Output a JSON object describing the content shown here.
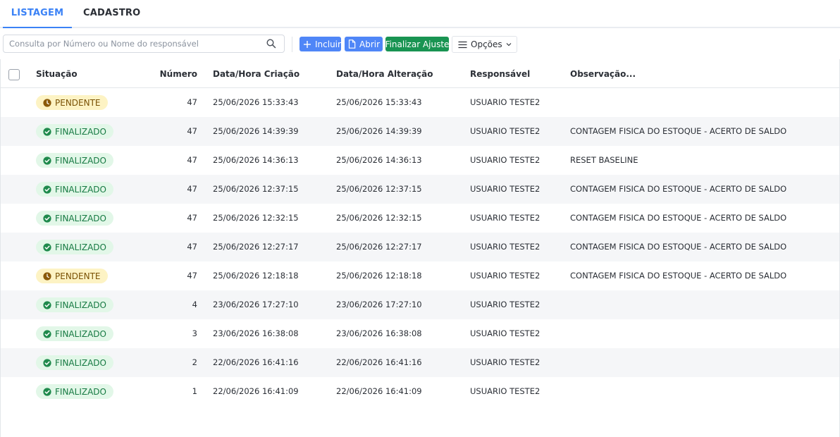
{
  "tabs": [
    {
      "label": "LISTAGEM"
    },
    {
      "label": "CADASTRO"
    }
  ],
  "search": {
    "placeholder": "Consulta por Número ou Nome do responsável",
    "value": ""
  },
  "toolbar": {
    "incluir_label": "Incluir",
    "abrir_label": "Abrir",
    "finalizar_label": "Finalizar Ajuste",
    "opcoes_label": "Opções"
  },
  "colors": {
    "accent": "#3b82f6",
    "blue_button": "#4f86f7",
    "green_button": "#199452",
    "finalizado": "#177a43",
    "pendente": "#7a5205"
  },
  "table": {
    "headers": {
      "situacao": "Situação",
      "numero": "Número",
      "criacao": "Data/Hora Criação",
      "alteracao": "Data/Hora Alteração",
      "responsavel": "Responsável",
      "observacao": "Observação..."
    },
    "rows": [
      {
        "situacao": "PENDENTE",
        "numero": "47",
        "criacao": "25/06/2026 15:33:43",
        "alteracao": "25/06/2026 15:33:43",
        "responsavel": "USUARIO TESTE2",
        "observacao": ""
      },
      {
        "situacao": "FINALIZADO",
        "numero": "47",
        "criacao": "25/06/2026 14:39:39",
        "alteracao": "25/06/2026 14:39:39",
        "responsavel": "USUARIO TESTE2",
        "observacao": "CONTAGEM FISICA DO ESTOQUE - ACERTO DE SALDO"
      },
      {
        "situacao": "FINALIZADO",
        "numero": "47",
        "criacao": "25/06/2026 14:36:13",
        "alteracao": "25/06/2026 14:36:13",
        "responsavel": "USUARIO TESTE2",
        "observacao": "RESET BASELINE"
      },
      {
        "situacao": "FINALIZADO",
        "numero": "47",
        "criacao": "25/06/2026 12:37:15",
        "alteracao": "25/06/2026 12:37:15",
        "responsavel": "USUARIO TESTE2",
        "observacao": "CONTAGEM FISICA DO ESTOQUE - ACERTO DE SALDO"
      },
      {
        "situacao": "FINALIZADO",
        "numero": "47",
        "criacao": "25/06/2026 12:32:15",
        "alteracao": "25/06/2026 12:32:15",
        "responsavel": "USUARIO TESTE2",
        "observacao": "CONTAGEM FISICA DO ESTOQUE - ACERTO DE SALDO"
      },
      {
        "situacao": "FINALIZADO",
        "numero": "47",
        "criacao": "25/06/2026 12:27:17",
        "alteracao": "25/06/2026 12:27:17",
        "responsavel": "USUARIO TESTE2",
        "observacao": "CONTAGEM FISICA DO ESTOQUE - ACERTO DE SALDO"
      },
      {
        "situacao": "PENDENTE",
        "numero": "47",
        "criacao": "25/06/2026 12:18:18",
        "alteracao": "25/06/2026 12:18:18",
        "responsavel": "USUARIO TESTE2",
        "observacao": "CONTAGEM FISICA DO ESTOQUE - ACERTO DE SALDO"
      },
      {
        "situacao": "FINALIZADO",
        "numero": "4",
        "criacao": "23/06/2026 17:27:10",
        "alteracao": "23/06/2026 17:27:10",
        "responsavel": "USUARIO TESTE2",
        "observacao": ""
      },
      {
        "situacao": "FINALIZADO",
        "numero": "3",
        "criacao": "23/06/2026 16:38:08",
        "alteracao": "23/06/2026 16:38:08",
        "responsavel": "USUARIO TESTE2",
        "observacao": ""
      },
      {
        "situacao": "FINALIZADO",
        "numero": "2",
        "criacao": "22/06/2026 16:41:16",
        "alteracao": "22/06/2026 16:41:16",
        "responsavel": "USUARIO TESTE2",
        "observacao": ""
      },
      {
        "situacao": "FINALIZADO",
        "numero": "1",
        "criacao": "22/06/2026 16:41:09",
        "alteracao": "22/06/2026 16:41:09",
        "responsavel": "USUARIO TESTE2",
        "observacao": ""
      }
    ]
  }
}
